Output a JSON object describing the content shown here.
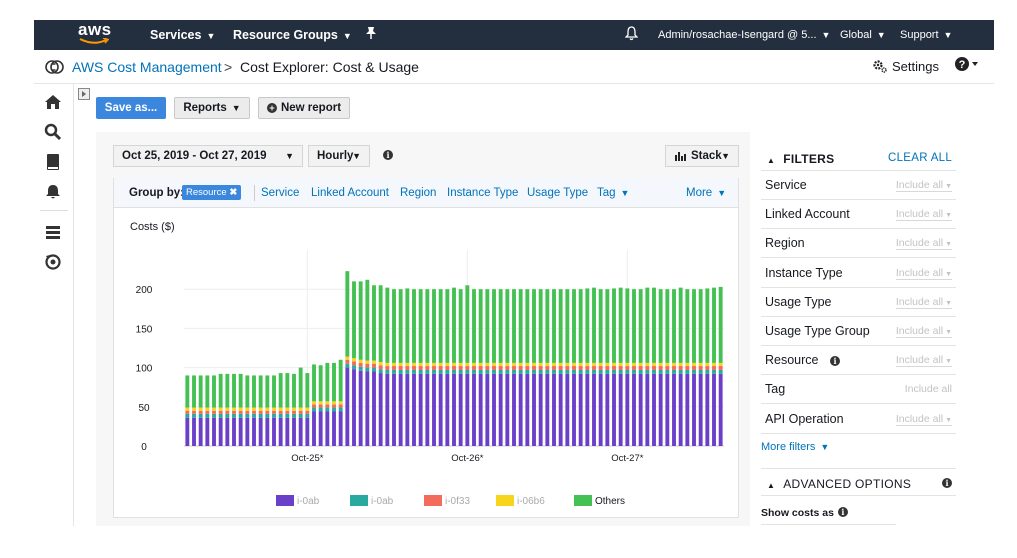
{
  "topnav": {
    "logo_text": "aws",
    "services": "Services",
    "resource_groups": "Resource Groups",
    "account": "Admin/rosachae-Isengard @ 5...",
    "region": "Global",
    "support": "Support"
  },
  "breadcrumb": {
    "parent": "AWS Cost Management",
    "separator": ">",
    "current": "Cost Explorer: Cost & Usage",
    "settings": "Settings"
  },
  "toolbar": {
    "save_as": "Save as...",
    "reports": "Reports",
    "new_report": "New report"
  },
  "controls": {
    "date_range": "Oct 25, 2019 - Oct 27, 2019",
    "granularity": "Hourly",
    "chart_style": "Stack"
  },
  "group_by": {
    "label": "Group by:",
    "selected": "Resource",
    "options": [
      "Service",
      "Linked Account",
      "Region",
      "Instance Type",
      "Usage Type",
      "Tag"
    ],
    "more": "More"
  },
  "filters": {
    "title": "FILTERS",
    "clear_all": "CLEAR ALL",
    "rows": [
      {
        "label": "Service",
        "value": "Include all"
      },
      {
        "label": "Linked Account",
        "value": "Include all"
      },
      {
        "label": "Region",
        "value": "Include all"
      },
      {
        "label": "Instance Type",
        "value": "Include all"
      },
      {
        "label": "Usage Type",
        "value": "Include all"
      },
      {
        "label": "Usage Type Group",
        "value": "Include all"
      },
      {
        "label": "Resource",
        "value": "Include all"
      },
      {
        "label": "Tag",
        "value": "Include all"
      },
      {
        "label": "API Operation",
        "value": "Include all"
      }
    ],
    "more_filters": "More filters"
  },
  "advanced": {
    "title": "ADVANCED OPTIONS",
    "show_costs_as": "Show costs as"
  },
  "colors": {
    "nav_bg": "#232f3e",
    "link": "#0073bb",
    "primary_button": "#3b87dd",
    "series": [
      "#6b40c9",
      "#2aa9a0",
      "#f26b5b",
      "#f7d51d",
      "#44c152"
    ]
  },
  "chart_data": {
    "type": "bar",
    "stacked": true,
    "ylabel": "Costs ($)",
    "ylim": [
      0,
      250
    ],
    "yticks": [
      0,
      50,
      100,
      150,
      200
    ],
    "xticks": [
      {
        "index": 18,
        "label": "Oct-25*"
      },
      {
        "index": 42,
        "label": "Oct-26*"
      },
      {
        "index": 66,
        "label": "Oct-27*"
      }
    ],
    "totals": [
      90,
      90,
      90,
      90,
      90,
      92,
      92,
      92,
      92,
      90,
      90,
      90,
      90,
      90,
      93,
      93,
      92,
      100,
      93,
      104,
      103,
      106,
      106,
      110,
      223,
      210,
      210,
      212,
      205,
      205,
      202,
      200,
      200,
      201,
      200,
      200,
      200,
      200,
      200,
      200,
      202,
      200,
      205,
      200,
      200,
      200,
      200,
      200,
      200,
      200,
      200,
      200,
      200,
      200,
      200,
      200,
      200,
      200,
      200,
      200,
      201,
      202,
      200,
      200,
      201,
      202,
      201,
      200,
      200,
      202,
      202,
      200,
      200,
      200,
      202,
      200,
      200,
      200,
      201,
      202,
      203
    ],
    "series": [
      {
        "name": "i-0ab",
        "values": [
          36,
          36,
          36,
          36,
          36,
          36,
          36,
          36,
          36,
          36,
          36,
          36,
          36,
          36,
          36,
          36,
          36,
          36,
          36,
          44,
          44,
          44,
          44,
          44,
          100,
          98,
          96,
          95,
          95,
          93,
          92,
          92,
          92,
          92,
          92,
          92,
          92,
          92,
          92,
          92,
          92,
          92,
          92,
          92,
          92,
          92,
          92,
          92,
          92,
          92,
          92,
          92,
          92,
          92,
          92,
          92,
          92,
          92,
          92,
          92,
          92,
          92,
          92,
          92,
          92,
          92,
          92,
          92,
          92,
          92,
          92,
          92,
          92,
          92,
          92,
          92,
          92,
          92,
          92,
          92,
          92
        ]
      },
      {
        "name": "i-0ab",
        "values": [
          5,
          5,
          5,
          5,
          5,
          5,
          5,
          5,
          5,
          5,
          5,
          5,
          5,
          5,
          5,
          5,
          5,
          5,
          5,
          5,
          5,
          5,
          5,
          5,
          5,
          5,
          5,
          5,
          5,
          5,
          5,
          5,
          5,
          5,
          5,
          5,
          5,
          5,
          5,
          5,
          5,
          5,
          5,
          5,
          5,
          5,
          5,
          5,
          5,
          5,
          5,
          5,
          5,
          5,
          5,
          5,
          5,
          5,
          5,
          5,
          5,
          5,
          5,
          5,
          5,
          5,
          5,
          5,
          5,
          5,
          5,
          5,
          5,
          5,
          5,
          5,
          5,
          5,
          5,
          5,
          5
        ]
      },
      {
        "name": "i-0f33",
        "values": [
          4,
          4,
          4,
          4,
          4,
          4,
          4,
          4,
          4,
          4,
          4,
          4,
          4,
          4,
          4,
          4,
          4,
          4,
          4,
          4,
          4,
          4,
          4,
          4,
          5,
          5,
          5,
          5,
          5,
          5,
          5,
          5,
          5,
          5,
          5,
          5,
          5,
          5,
          5,
          5,
          5,
          5,
          5,
          5,
          5,
          5,
          5,
          5,
          5,
          5,
          5,
          5,
          5,
          5,
          5,
          5,
          5,
          5,
          5,
          5,
          5,
          5,
          5,
          5,
          5,
          5,
          5,
          5,
          5,
          5,
          5,
          5,
          5,
          5,
          5,
          5,
          5,
          5,
          5,
          5,
          5
        ]
      },
      {
        "name": "i-06b6",
        "values": [
          4,
          4,
          4,
          4,
          4,
          4,
          4,
          4,
          4,
          4,
          4,
          4,
          4,
          4,
          4,
          4,
          4,
          4,
          4,
          4,
          4,
          4,
          4,
          4,
          4,
          4,
          4,
          4,
          4,
          4,
          4,
          4,
          4,
          4,
          4,
          4,
          4,
          4,
          4,
          4,
          4,
          4,
          4,
          4,
          4,
          4,
          4,
          4,
          4,
          4,
          4,
          4,
          4,
          4,
          4,
          4,
          4,
          4,
          4,
          4,
          4,
          4,
          4,
          4,
          4,
          4,
          4,
          4,
          4,
          4,
          4,
          4,
          4,
          4,
          4,
          4,
          4,
          4,
          4,
          4,
          4
        ]
      },
      {
        "name": "Others",
        "values": [
          41,
          41,
          41,
          41,
          41,
          43,
          43,
          43,
          43,
          41,
          41,
          41,
          41,
          41,
          44,
          44,
          43,
          51,
          44,
          47,
          46,
          49,
          49,
          53,
          109,
          98,
          100,
          103,
          96,
          98,
          96,
          94,
          94,
          95,
          94,
          94,
          94,
          94,
          94,
          94,
          96,
          94,
          99,
          94,
          94,
          94,
          94,
          94,
          94,
          94,
          94,
          94,
          94,
          94,
          94,
          94,
          94,
          94,
          94,
          94,
          95,
          96,
          94,
          94,
          95,
          96,
          95,
          94,
          94,
          96,
          96,
          94,
          94,
          94,
          96,
          94,
          94,
          94,
          95,
          96,
          97
        ]
      }
    ]
  }
}
